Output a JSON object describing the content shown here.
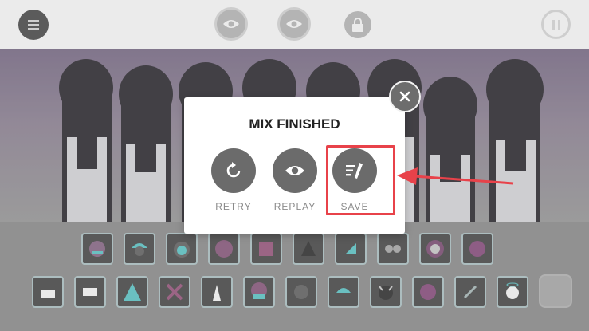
{
  "toolbar": {
    "menu_icon": "hamburger-icon",
    "eye_icon": "eye-icon",
    "lock_icon": "lock-icon",
    "pause_icon": "pause-icon"
  },
  "modal": {
    "title": "MIX FINISHED",
    "actions": [
      {
        "label": "RETRY",
        "icon": "retry-icon"
      },
      {
        "label": "REPLAY",
        "icon": "eye-icon"
      },
      {
        "label": "SAVE",
        "icon": "save-edit-icon"
      }
    ],
    "close_icon": "close-icon"
  },
  "annotation": {
    "color": "#e8424a"
  },
  "colors": {
    "modal_bg": "#ffffff",
    "button": "#6b6b6b",
    "label": "#8b8b8b"
  }
}
